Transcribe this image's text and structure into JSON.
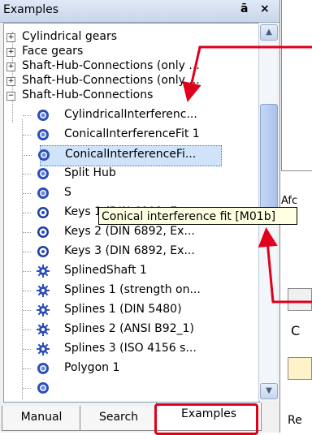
{
  "panel": {
    "title": "Examples",
    "pin_icon": "pin-icon",
    "close_icon": "close-icon",
    "pin_glyph": "ā",
    "close_glyph": "×"
  },
  "tree": {
    "items": [
      {
        "label": "Cylindrical gears",
        "expander": "+"
      },
      {
        "label": "Face gears",
        "expander": "+"
      },
      {
        "label": "Shaft-Hub-Connections (only ...",
        "expander": "+"
      },
      {
        "label": "Shaft-Hub-Connections (only ...",
        "expander": "+"
      },
      {
        "label": "Shaft-Hub-Connections",
        "expander": "−"
      },
      {
        "label": "CylindricalInterferenc...",
        "icon": "sphere-icon"
      },
      {
        "label": "ConicalInterferenceFit 1",
        "icon": "sphere-icon"
      },
      {
        "label": "ConicalInterferenceFi...",
        "icon": "sphere-icon",
        "selected": true
      },
      {
        "label": "Split Hub",
        "icon": "sphere-icon"
      },
      {
        "label": "S",
        "icon": "sphere-icon"
      },
      {
        "label": "Keys 1 (DIN 6892, Ex...",
        "icon": "ring-icon"
      },
      {
        "label": "Keys 2 (DIN 6892, Ex...",
        "icon": "ring-icon"
      },
      {
        "label": "Keys 3 (DIN 6892, Ex...",
        "icon": "ring-icon"
      },
      {
        "label": "SplinedShaft 1",
        "icon": "gear-icon"
      },
      {
        "label": "Splines 1 (strength on...",
        "icon": "gear-icon"
      },
      {
        "label": "Splines 1 (DIN 5480)",
        "icon": "gear-icon"
      },
      {
        "label": "Splines 2 (ANSI B92_1)",
        "icon": "gear-icon"
      },
      {
        "label": "Splines 3 (ISO 4156 s...",
        "icon": "gear-icon"
      },
      {
        "label": "Polygon 1",
        "icon": "sphere-icon"
      },
      {
        "label": "",
        "icon": "sphere-icon"
      }
    ]
  },
  "tooltip": {
    "text": "Conical interference fit [M01b]"
  },
  "tabs": [
    {
      "label": "Manual"
    },
    {
      "label": "Search"
    },
    {
      "label": "Examples",
      "active": true
    }
  ],
  "right_panel": {
    "tab_fragment": "Re",
    "side_letter": "Afc",
    "radio_letter": "C"
  },
  "colors": {
    "annotation_red": "#e0001b",
    "selection": "#cfe3fb",
    "tooltip_bg": "#ffffe1"
  }
}
